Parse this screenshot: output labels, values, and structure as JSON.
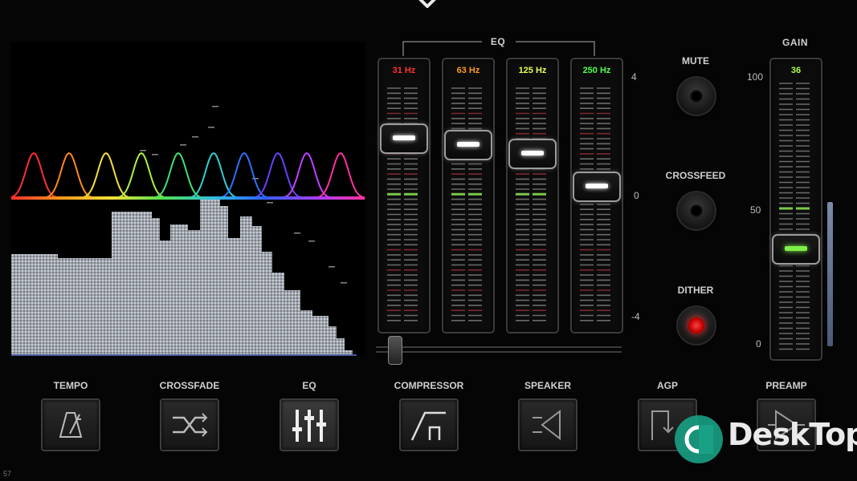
{
  "eq": {
    "title": "EQ",
    "bands": [
      {
        "label": "31 Hz",
        "color": "#ff3030",
        "db": 2.0
      },
      {
        "label": "63 Hz",
        "color": "#ff9a1a",
        "db": 1.8
      },
      {
        "label": "125 Hz",
        "color": "#e8ff50",
        "db": 1.5
      },
      {
        "label": "250 Hz",
        "color": "#50ff50",
        "db": 0.4
      }
    ],
    "scale": {
      "top": "4",
      "mid": "0",
      "bottom": "-4"
    }
  },
  "controls": {
    "mute": "MUTE",
    "crossfeed": "CROSSFEED",
    "dither": "DITHER",
    "dither_active_color": "#ff2020"
  },
  "gain": {
    "title": "GAIN",
    "value": "36",
    "value_color": "#a8ff50",
    "level_fraction": 0.36,
    "scale": {
      "top": "100",
      "mid": "50",
      "bottom": "0"
    }
  },
  "tools": [
    {
      "label": "TEMPO",
      "icon": "metronome-icon"
    },
    {
      "label": "CROSSFADE",
      "icon": "crossfade-icon"
    },
    {
      "label": "EQ",
      "icon": "equalizer-sliders-icon"
    },
    {
      "label": "COMPRESSOR",
      "icon": "compressor-curve-icon"
    },
    {
      "label": "SPEAKER",
      "icon": "speaker-icon"
    },
    {
      "label": "AGP",
      "icon": "agp-icon"
    },
    {
      "label": "PREAMP",
      "icon": "preamp-icon"
    }
  ],
  "status": {
    "version": "57"
  },
  "watermark": {
    "text": "DeskTop"
  }
}
